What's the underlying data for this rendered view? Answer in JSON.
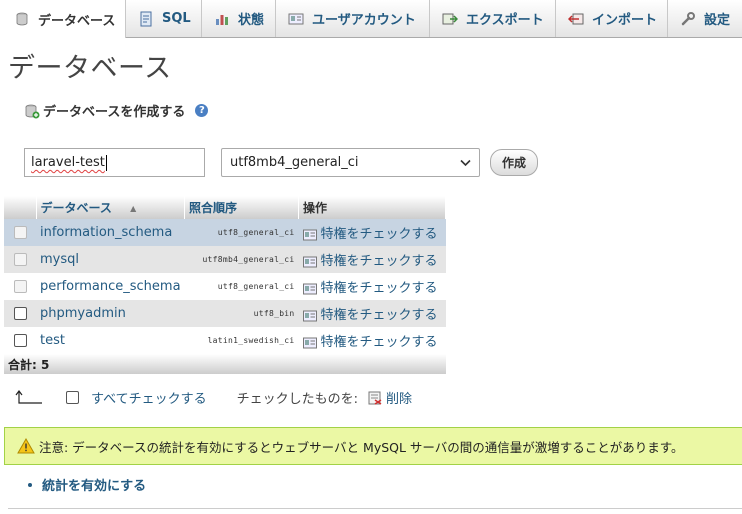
{
  "tabs": [
    {
      "label": "データベース",
      "icon": "database-icon",
      "active": true
    },
    {
      "label": "SQL",
      "icon": "sql-icon",
      "active": false
    },
    {
      "label": "状態",
      "icon": "status-icon",
      "active": false
    },
    {
      "label": "ユーザアカウント",
      "icon": "users-icon",
      "active": false
    },
    {
      "label": "エクスポート",
      "icon": "export-icon",
      "active": false
    },
    {
      "label": "インポート",
      "icon": "import-icon",
      "active": false
    },
    {
      "label": "設定",
      "icon": "wrench-icon",
      "active": false
    }
  ],
  "page_title": "データベース",
  "create": {
    "heading": "データベースを作成する",
    "help": "?",
    "db_name_value": "laravel-test",
    "collation_selected": "utf8mb4_general_ci",
    "create_label": "作成"
  },
  "table": {
    "headers": {
      "database": "データベース",
      "collation": "照合順序",
      "action": "操作"
    },
    "rows": [
      {
        "name": "information_schema",
        "collation": "utf8_general_ci",
        "action": "特権をチェックする",
        "system": true
      },
      {
        "name": "mysql",
        "collation": "utf8mb4_general_ci",
        "action": "特権をチェックする",
        "system": true
      },
      {
        "name": "performance_schema",
        "collation": "utf8_general_ci",
        "action": "特権をチェックする",
        "system": true
      },
      {
        "name": "phpmyadmin",
        "collation": "utf8_bin",
        "action": "特権をチェックする",
        "system": false
      },
      {
        "name": "test",
        "collation": "latin1_swedish_ci",
        "action": "特権をチェックする",
        "system": false
      }
    ],
    "total": "合計: 5"
  },
  "bulk": {
    "check_all": "すべてチェックする",
    "with_selected": "チェックしたものを:",
    "delete": "削除"
  },
  "notice": {
    "text": "注意: データベースの統計を有効にするとウェブサーバと MySQL サーバの間の通信量が激増することがあります。"
  },
  "enable_stats": "統計を有効にする",
  "colors": {
    "link": "#235a81",
    "notice_bg": "#ebf8a4",
    "notice_border": "#a2d246",
    "marked_row": "#c7d4e2"
  }
}
